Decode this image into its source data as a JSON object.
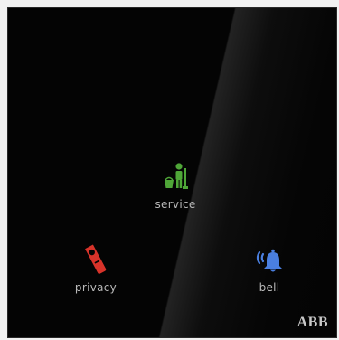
{
  "panel": {
    "buttons": [
      {
        "id": "service",
        "label": "service",
        "icon": "service-icon",
        "color": "#4fa638"
      },
      {
        "id": "privacy",
        "label": "privacy",
        "icon": "do-not-disturb-tag-icon",
        "color": "#d8332a"
      },
      {
        "id": "bell",
        "label": "bell",
        "icon": "bell-icon",
        "color": "#4a7fe0"
      }
    ],
    "brand": "ABB"
  },
  "colors": {
    "panel_background": "#040404",
    "label_text": "#b9b9b9"
  }
}
